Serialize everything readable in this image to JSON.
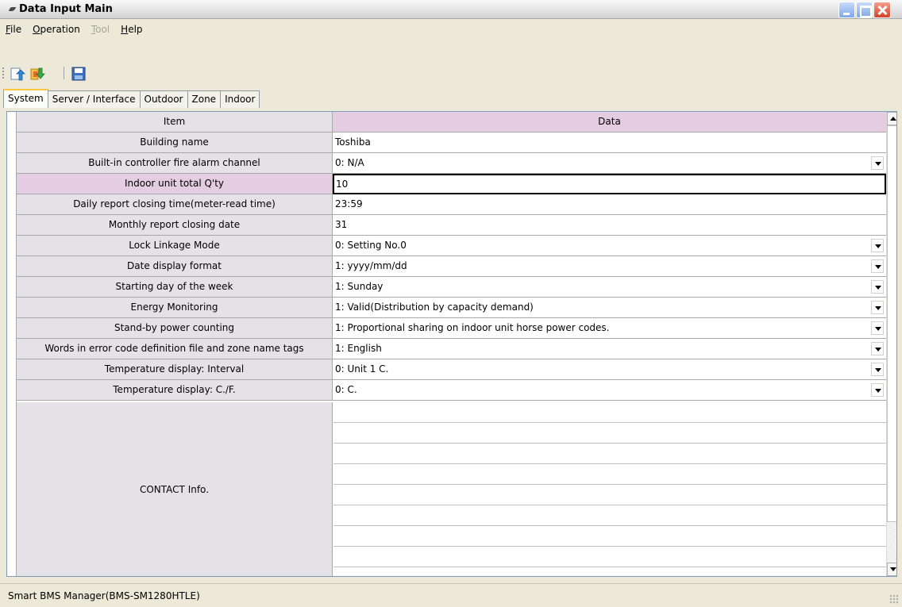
{
  "window": {
    "title": "Data Input Main"
  },
  "menu": [
    {
      "label": "File",
      "mnemonic": "F",
      "rest": "ile",
      "disabled": false
    },
    {
      "label": "Operation",
      "mnemonic": "O",
      "rest": "peration",
      "disabled": false
    },
    {
      "label": "Tool",
      "mnemonic": "T",
      "rest": "ool",
      "disabled": true
    },
    {
      "label": "Help",
      "mnemonic": "H",
      "rest": "elp",
      "disabled": false
    }
  ],
  "toolbar": {
    "icons": [
      "import-icon",
      "export-icon",
      "save-icon"
    ]
  },
  "tabs": [
    "System",
    "Server / Interface",
    "Outdoor",
    "Zone",
    "Indoor"
  ],
  "grid": {
    "headers": {
      "item": "Item",
      "data": "Data"
    },
    "rows": [
      {
        "item": "Building name",
        "data": "Toshiba",
        "dropdown": false
      },
      {
        "item": "Built-in controller fire alarm channel",
        "data": "0: N/A",
        "dropdown": true
      },
      {
        "item": "Indoor unit total Q'ty",
        "data": "10",
        "dropdown": false,
        "selected": true
      },
      {
        "item": "Daily report closing time(meter-read time)",
        "data": "23:59",
        "dropdown": false
      },
      {
        "item": "Monthly report closing date",
        "data": "31",
        "dropdown": false
      },
      {
        "item": "Lock Linkage Mode",
        "data": "0: Setting No.0",
        "dropdown": true
      },
      {
        "item": "Date display format",
        "data": "1: yyyy/mm/dd",
        "dropdown": true
      },
      {
        "item": "Starting day of the week",
        "data": "1: Sunday",
        "dropdown": true
      },
      {
        "item": "Energy Monitoring",
        "data": "1: Valid(Distribution by capacity demand)",
        "dropdown": true
      },
      {
        "item": "Stand-by power counting",
        "data": "1: Proportional sharing on indoor unit horse power codes.",
        "dropdown": true
      },
      {
        "item": "Words in error code definition file and zone name tags",
        "data": "1: English",
        "dropdown": true
      },
      {
        "item": "Temperature display: Interval",
        "data": "0: Unit 1 C.",
        "dropdown": true
      },
      {
        "item": "Temperature display: C./F.",
        "data": "0: C.",
        "dropdown": true
      }
    ],
    "contact_label": "CONTACT Info."
  },
  "status": {
    "text": "Smart BMS Manager(BMS-SM1280HTLE)"
  },
  "colors": {
    "header_data_bg": "#e4cde2",
    "item_bg": "#e5e2e7",
    "active_tab_accent": "#ffc83c"
  }
}
